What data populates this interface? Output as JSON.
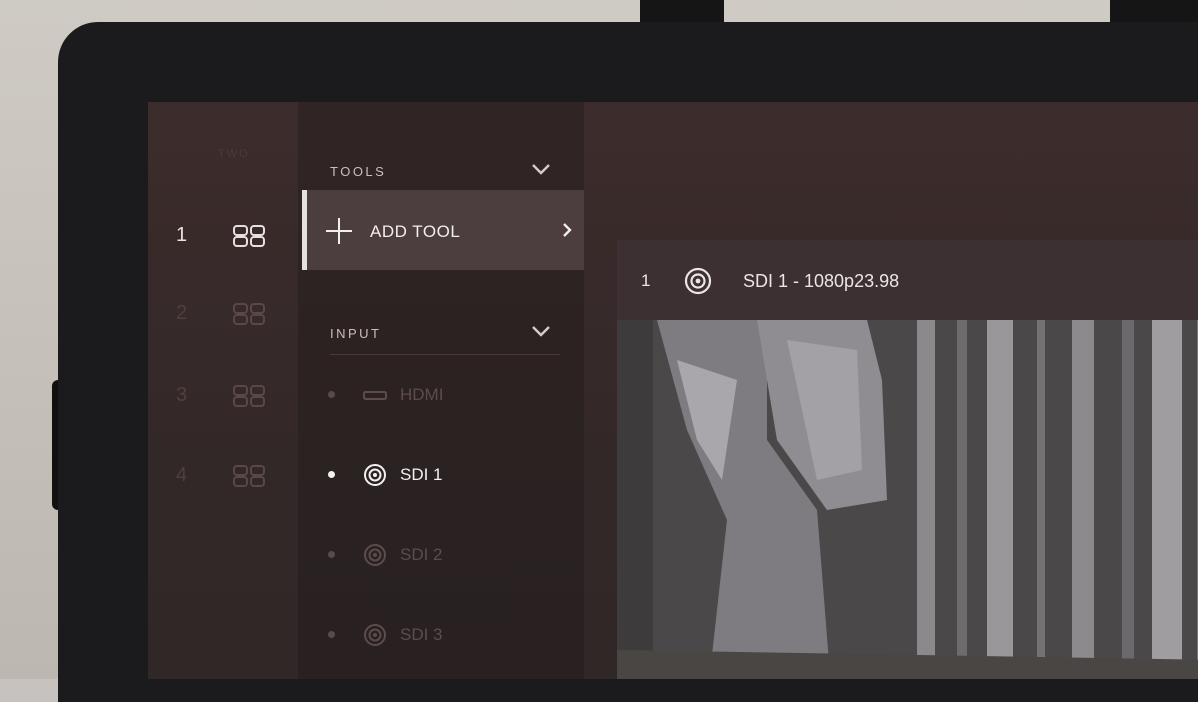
{
  "rail": {
    "heading": "TWO",
    "items": [
      {
        "number": "1",
        "icon": "layout-quad-icon"
      },
      {
        "number": "2",
        "icon": "layout-quad-icon"
      },
      {
        "number": "3",
        "icon": "layout-quad-icon"
      },
      {
        "number": "4",
        "icon": "layout-quad-icon"
      }
    ]
  },
  "tools": {
    "section_label": "TOOLS",
    "add_tool_label": "ADD TOOL"
  },
  "input": {
    "section_label": "INPUT",
    "items": [
      {
        "label": "HDMI",
        "icon": "hdmi-port-icon",
        "active": false
      },
      {
        "label": "SDI 1",
        "icon": "sdi-connector-icon",
        "active": true
      },
      {
        "label": "SDI 2",
        "icon": "sdi-connector-icon",
        "active": false
      },
      {
        "label": "SDI 3",
        "icon": "sdi-connector-icon",
        "active": false
      }
    ]
  },
  "viewer": {
    "number": "1",
    "source_title": "SDI 1 - 1080p23.98",
    "icon": "sdi-connector-icon"
  },
  "colors": {
    "screen_bg": "#3d2c2c",
    "highlight_bg": "#4c3d3e",
    "accent": "#e6e0de",
    "dim_text": "#5e4c4c"
  }
}
